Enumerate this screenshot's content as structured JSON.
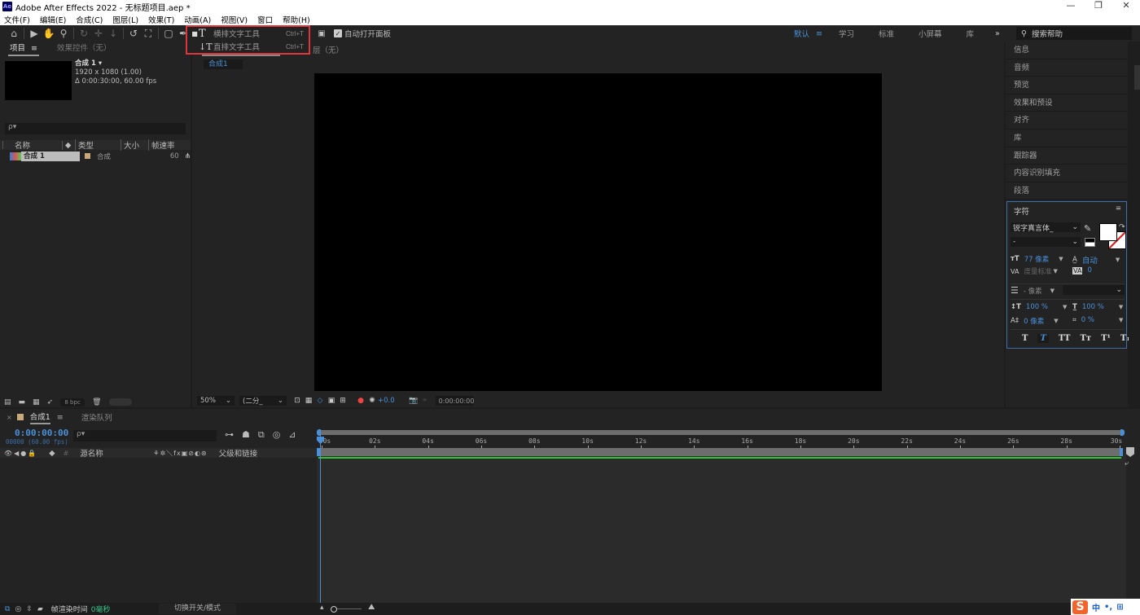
{
  "window": {
    "app_badge": "Ae",
    "title": "Adobe After Effects 2022 - 无标题项目.aep *",
    "controls": {
      "minimize": "—",
      "restore": "❐",
      "close": "✕"
    }
  },
  "menubar": [
    "文件(F)",
    "编辑(E)",
    "合成(C)",
    "图层(L)",
    "效果(T)",
    "动画(A)",
    "视图(V)",
    "窗口",
    "帮助(H)"
  ],
  "toolbar": {
    "tools": [
      "home-icon",
      "selection-icon",
      "hand-icon",
      "zoom-icon",
      "orbit-icon",
      "pan-icon",
      "dolly-icon",
      "rotate-icon",
      "anchor-icon",
      "rectangle-icon",
      "pen-icon",
      "type-icon"
    ],
    "auto_open_label": "自动打开面板",
    "auto_open_checked": true,
    "workspaces": [
      {
        "label": "默认",
        "active": true
      },
      {
        "label": "学习"
      },
      {
        "label": "标准"
      },
      {
        "label": "小屏幕"
      },
      {
        "label": "库"
      }
    ],
    "more": "»",
    "search_placeholder": "搜索帮助"
  },
  "text_tool_menu": {
    "items": [
      {
        "label": "横排文字工具",
        "shortcut": "Ctrl+T",
        "selected": true,
        "glyph": "T"
      },
      {
        "label": "直排文字工具",
        "shortcut": "Ctrl+T",
        "selected": false,
        "glyph": "↓T"
      }
    ]
  },
  "project_panel": {
    "tabs": [
      "项目",
      "效果控件（无）"
    ],
    "comp_name": "合成 1 ▾",
    "comp_resolution": "1920 x 1080 (1.00)",
    "comp_duration": "Δ 0:00:30:00, 60.00 fps",
    "search_placeholder": "ρ▾",
    "columns": [
      "名称",
      "类型",
      "大小",
      "帧速率"
    ],
    "rows": [
      {
        "name": "合成 1",
        "type": "合成",
        "size": "",
        "fps": "60",
        "label_color": "#c8a97a"
      }
    ],
    "bpc": "8 bpc"
  },
  "comp_panel": {
    "tab_partial": "层（无）",
    "comp_tab": "合成1",
    "zoom": "50%",
    "resolution": "(二分_",
    "exposure": "+0.0",
    "timecode": "0:00:00:00"
  },
  "right_panel": {
    "items": [
      "信息",
      "音频",
      "预览",
      "效果和预设",
      "对齐",
      "库",
      "跟踪器",
      "内容识别填充",
      "段落"
    ],
    "character": {
      "title": "字符",
      "font": "锐字真言体_",
      "style": "-",
      "font_size": "77 像素",
      "leading": "自动",
      "kerning": "度量标准",
      "tracking": "0",
      "stroke_width": "- 像素",
      "vert_scale": "100 %",
      "horiz_scale": "100 %",
      "baseline_shift": "0 像素",
      "tsume": "0 %",
      "fill_color": "#ffffff",
      "styles": [
        "T",
        "T",
        "TT",
        "Tт",
        "T¹",
        "T₁"
      ]
    }
  },
  "timeline": {
    "tabs": [
      "合成1",
      "渲染队列"
    ],
    "current_time": "0:00:00:00",
    "frame_info": "00000 (60.00 fps)",
    "search_placeholder": "ρ▾",
    "columns": {
      "source_name": "源名称",
      "parent": "父级和链接"
    },
    "ruler_labels": [
      "00s",
      "02s",
      "04s",
      "06s",
      "08s",
      "10s",
      "12s",
      "14s",
      "16s",
      "18s",
      "20s",
      "22s",
      "24s",
      "26s",
      "28s",
      "30s"
    ],
    "duration_seconds": 30,
    "playhead_seconds": 0
  },
  "statusbar": {
    "render_label": "帧渲染时间",
    "render_value": "0毫秒",
    "switch_label": "切换开关/模式"
  },
  "ime": {
    "logo": "S",
    "lang": "中",
    "punct": "•,",
    "menu": "⊞"
  }
}
